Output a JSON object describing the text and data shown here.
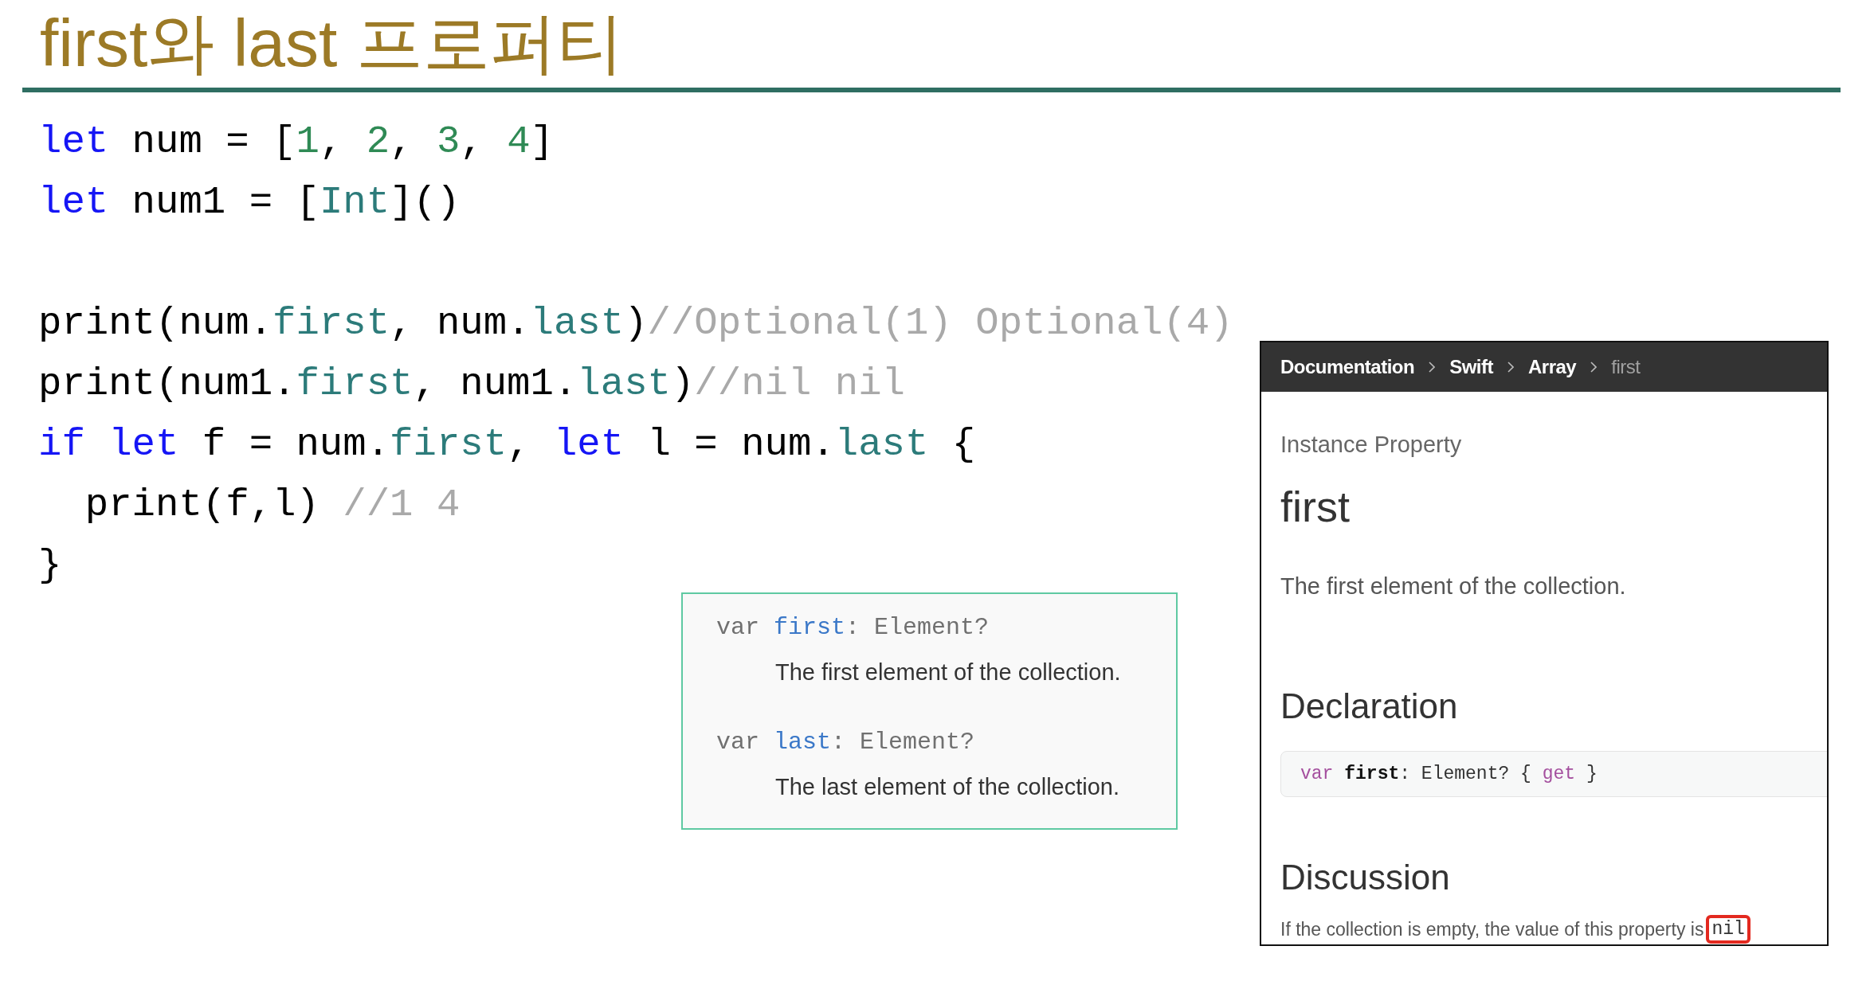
{
  "title": "first와 last 프로퍼티",
  "code": {
    "blocks": [
      [
        {
          "tokens": [
            {
              "text": "let",
              "kind": "keyword"
            },
            {
              "text": " num = [",
              "kind": "plain"
            },
            {
              "text": "1",
              "kind": "number"
            },
            {
              "text": ", ",
              "kind": "plain"
            },
            {
              "text": "2",
              "kind": "number"
            },
            {
              "text": ", ",
              "kind": "plain"
            },
            {
              "text": "3",
              "kind": "number"
            },
            {
              "text": ", ",
              "kind": "plain"
            },
            {
              "text": "4",
              "kind": "number"
            },
            {
              "text": "]",
              "kind": "plain"
            }
          ]
        },
        {
          "tokens": [
            {
              "text": "let",
              "kind": "keyword"
            },
            {
              "text": " num1 = [",
              "kind": "plain"
            },
            {
              "text": "Int",
              "kind": "type"
            },
            {
              "text": "]()",
              "kind": "plain"
            }
          ]
        }
      ],
      [
        {
          "tokens": [
            {
              "text": "print(num.",
              "kind": "plain"
            },
            {
              "text": "first",
              "kind": "type"
            },
            {
              "text": ", num.",
              "kind": "plain"
            },
            {
              "text": "last",
              "kind": "type"
            },
            {
              "text": ")",
              "kind": "plain"
            },
            {
              "text": "//Optional(1) Optional(4)",
              "kind": "comment"
            }
          ]
        },
        {
          "tokens": [
            {
              "text": "print(num1.",
              "kind": "plain"
            },
            {
              "text": "first",
              "kind": "type"
            },
            {
              "text": ", num1.",
              "kind": "plain"
            },
            {
              "text": "last",
              "kind": "type"
            },
            {
              "text": ")",
              "kind": "plain"
            },
            {
              "text": "//nil nil",
              "kind": "comment"
            }
          ]
        },
        {
          "tokens": [
            {
              "text": "if let",
              "kind": "keyword"
            },
            {
              "text": " f = num.",
              "kind": "plain"
            },
            {
              "text": "first",
              "kind": "type"
            },
            {
              "text": ", ",
              "kind": "plain"
            },
            {
              "text": "let",
              "kind": "keyword"
            },
            {
              "text": " l = num.",
              "kind": "plain"
            },
            {
              "text": "last",
              "kind": "type"
            },
            {
              "text": " {",
              "kind": "plain"
            }
          ]
        },
        {
          "tokens": [
            {
              "text": "  print(f,l) ",
              "kind": "plain"
            },
            {
              "text": "//1 4",
              "kind": "comment"
            }
          ]
        },
        {
          "tokens": [
            {
              "text": "}",
              "kind": "plain"
            }
          ]
        }
      ]
    ]
  },
  "quick_help": {
    "entries": [
      {
        "declaration": [
          {
            "text": "var ",
            "kind": "keyword"
          },
          {
            "text": "first",
            "kind": "name"
          },
          {
            "text": ": Element?",
            "kind": "plain"
          }
        ],
        "summary": "The first element of the collection."
      },
      {
        "declaration": [
          {
            "text": "var ",
            "kind": "keyword"
          },
          {
            "text": "last",
            "kind": "name"
          },
          {
            "text": ": Element?",
            "kind": "plain"
          }
        ],
        "summary": "The last element of the collection."
      }
    ]
  },
  "doc": {
    "breadcrumbs": [
      {
        "label": "Documentation",
        "current": false
      },
      {
        "label": "Swift",
        "current": false
      },
      {
        "label": "Array",
        "current": false
      },
      {
        "label": "first",
        "current": true
      }
    ],
    "kind_label": "Instance Property",
    "name": "first",
    "abstract": "The first element of the collection.",
    "sections": [
      {
        "kind": "code",
        "heading": "Declaration",
        "tokens": [
          {
            "text": "var ",
            "kind": "keyword"
          },
          {
            "text": "first",
            "kind": "name"
          },
          {
            "text": ": Element? { ",
            "kind": "plain"
          },
          {
            "text": "get",
            "kind": "keyword"
          },
          {
            "text": " }",
            "kind": "plain"
          }
        ]
      },
      {
        "kind": "text",
        "heading": "Discussion",
        "text": "If the collection is empty, the value of this property is",
        "code": "nil",
        "highlighted": true
      }
    ]
  }
}
